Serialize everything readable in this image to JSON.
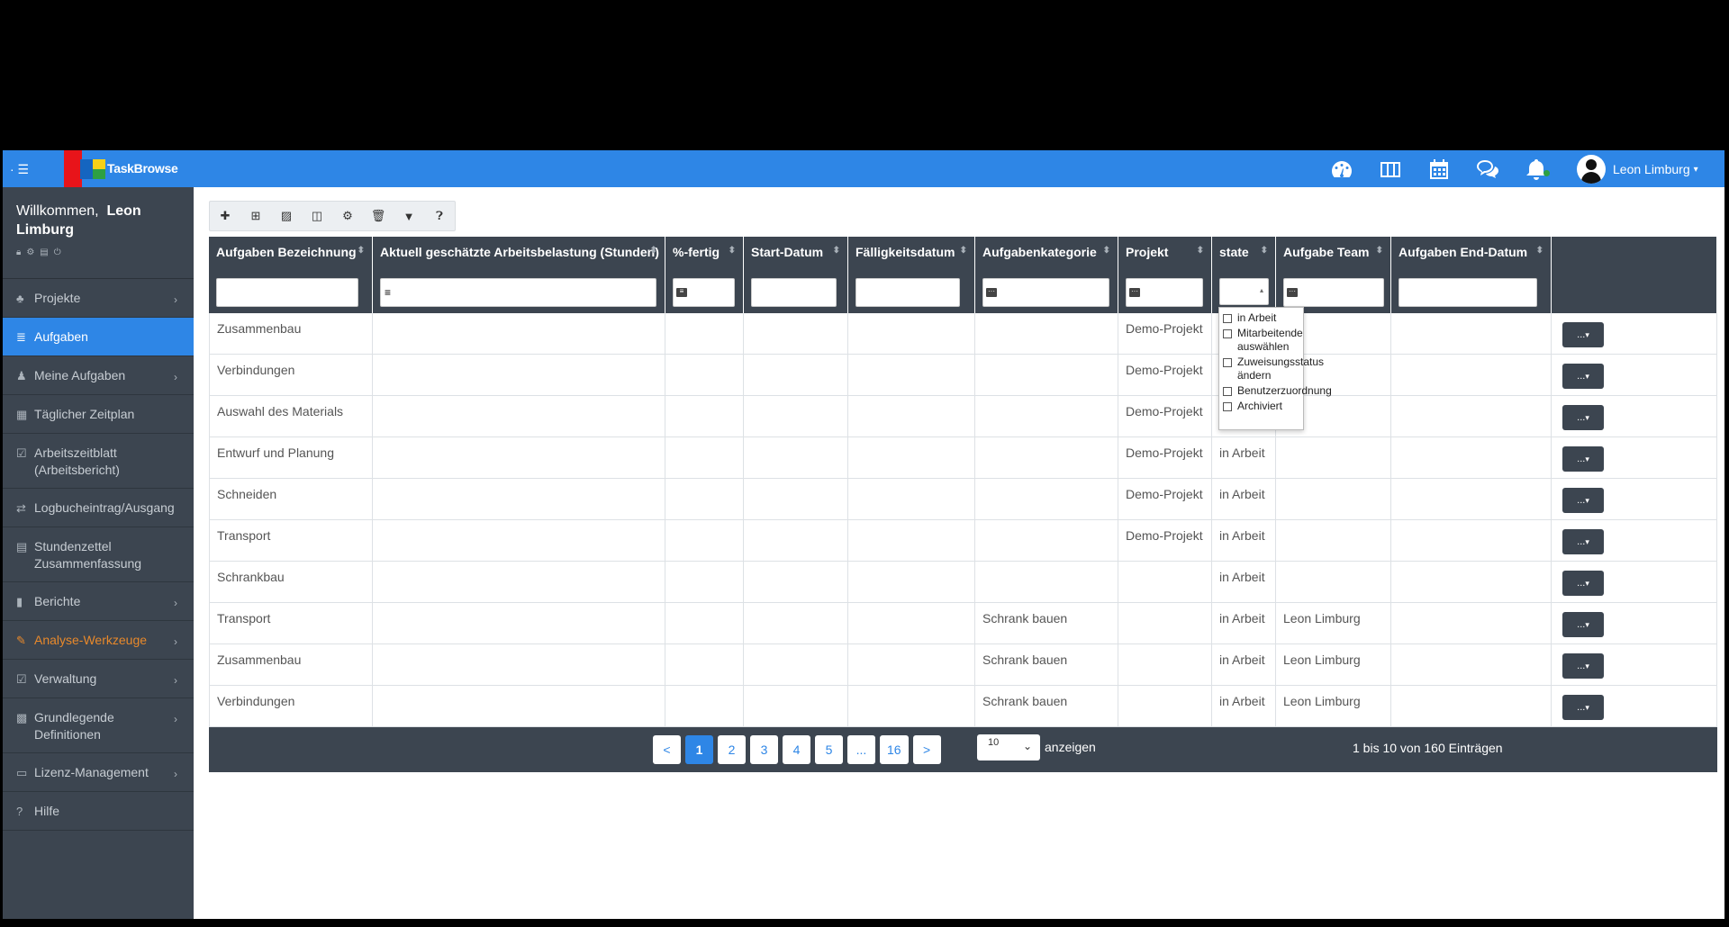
{
  "app": {
    "brand": "TaskBrowse"
  },
  "user": {
    "name": "Leon Limburg"
  },
  "top_icons": [
    "dashboard-icon",
    "columns-icon",
    "calendar-icon",
    "chat-icon",
    "bell-icon"
  ],
  "sidebar": {
    "welcome": "Willkommen,",
    "user_name": "Leon Limburg",
    "items": [
      {
        "label": "Projekte",
        "icon": "projects-icon",
        "chevron": true
      },
      {
        "label": "Aufgaben",
        "icon": "list-icon",
        "active": true
      },
      {
        "label": "Meine Aufgaben",
        "icon": "person-icon",
        "chevron": true
      },
      {
        "label": "Täglicher Zeitplan",
        "icon": "grid-icon"
      },
      {
        "label": "Arbeitszeitblatt (Arbeitsbericht)",
        "icon": "calendar-check-icon"
      },
      {
        "label": "Logbucheintrag/Ausgang",
        "icon": "exchange-icon"
      },
      {
        "label": "Stundenzettel Zusammenfassung",
        "icon": "list-alt-icon"
      },
      {
        "label": "Berichte",
        "icon": "file-icon",
        "chevron": true
      },
      {
        "label": "Analyse-Werkzeuge",
        "icon": "wand-icon",
        "chevron": true,
        "highlight": "#e8892b"
      },
      {
        "label": "Verwaltung",
        "icon": "check-square-icon",
        "chevron": true
      },
      {
        "label": "Grundlegende Definitionen",
        "icon": "cubes-icon",
        "chevron": true
      },
      {
        "label": "Lizenz-Management",
        "icon": "id-card-icon",
        "chevron": true
      },
      {
        "label": "Hilfe",
        "icon": "help-circle-icon"
      }
    ]
  },
  "toolbar": [
    "add-icon",
    "add-box-icon",
    "excel-icon",
    "columns-icon",
    "gear-icon",
    "trash-icon",
    "filter-icon",
    "help-icon"
  ],
  "table": {
    "columns": [
      "Aufgaben Bezeichnung",
      "Aktuell geschätzte Arbeitsbelastung (Stunden)",
      "%-fertig",
      "Start-Datum",
      "Fälligkeitsdatum",
      "Aufgabenkategorie",
      "Projekt",
      "state",
      "Aufgabe Team",
      "Aufgaben End-Datum",
      ""
    ],
    "rows": [
      [
        "Zusammenbau",
        "",
        "",
        "",
        "",
        "",
        "Demo-Projekt",
        "",
        "",
        ""
      ],
      [
        "Verbindungen",
        "",
        "",
        "",
        "",
        "",
        "Demo-Projekt",
        "",
        "",
        ""
      ],
      [
        "Auswahl des Materials",
        "",
        "",
        "",
        "",
        "",
        "Demo-Projekt",
        "",
        "",
        ""
      ],
      [
        "Entwurf und Planung",
        "",
        "",
        "",
        "",
        "",
        "Demo-Projekt",
        "in Arbeit",
        "",
        ""
      ],
      [
        "Schneiden",
        "",
        "",
        "",
        "",
        "",
        "Demo-Projekt",
        "in Arbeit",
        "",
        ""
      ],
      [
        "Transport",
        "",
        "",
        "",
        "",
        "",
        "Demo-Projekt",
        "in Arbeit",
        "",
        ""
      ],
      [
        "Schrankbau",
        "",
        "",
        "",
        "",
        "",
        "",
        "in Arbeit",
        "",
        ""
      ],
      [
        "Transport",
        "",
        "",
        "",
        "",
        "Schrank bauen",
        "",
        "in Arbeit",
        "Leon Limburg",
        ""
      ],
      [
        "Zusammenbau",
        "",
        "",
        "",
        "",
        "Schrank bauen",
        "",
        "in Arbeit",
        "Leon Limburg",
        ""
      ],
      [
        "Verbindungen",
        "",
        "",
        "",
        "",
        "Schrank bauen",
        "",
        "in Arbeit",
        "Leon Limburg",
        ""
      ]
    ],
    "action_label": "...",
    "state_filter_options": [
      "in Arbeit",
      "Mitarbeitende\nauswählen",
      "Zuweisungsstatus\nändern",
      "Benutzerzuordnung",
      "Archiviert"
    ]
  },
  "pagination": {
    "prev": "<",
    "pages": [
      "1",
      "2",
      "3",
      "4",
      "5",
      "...",
      "16"
    ],
    "next": ">",
    "current": "1",
    "page_size": "10",
    "show_label": "anzeigen",
    "info": "1 bis 10 von 160 Einträgen"
  },
  "colors": {
    "accent": "#2e86e6",
    "sidebar": "#3c4550",
    "highlight": "#e8892b"
  }
}
